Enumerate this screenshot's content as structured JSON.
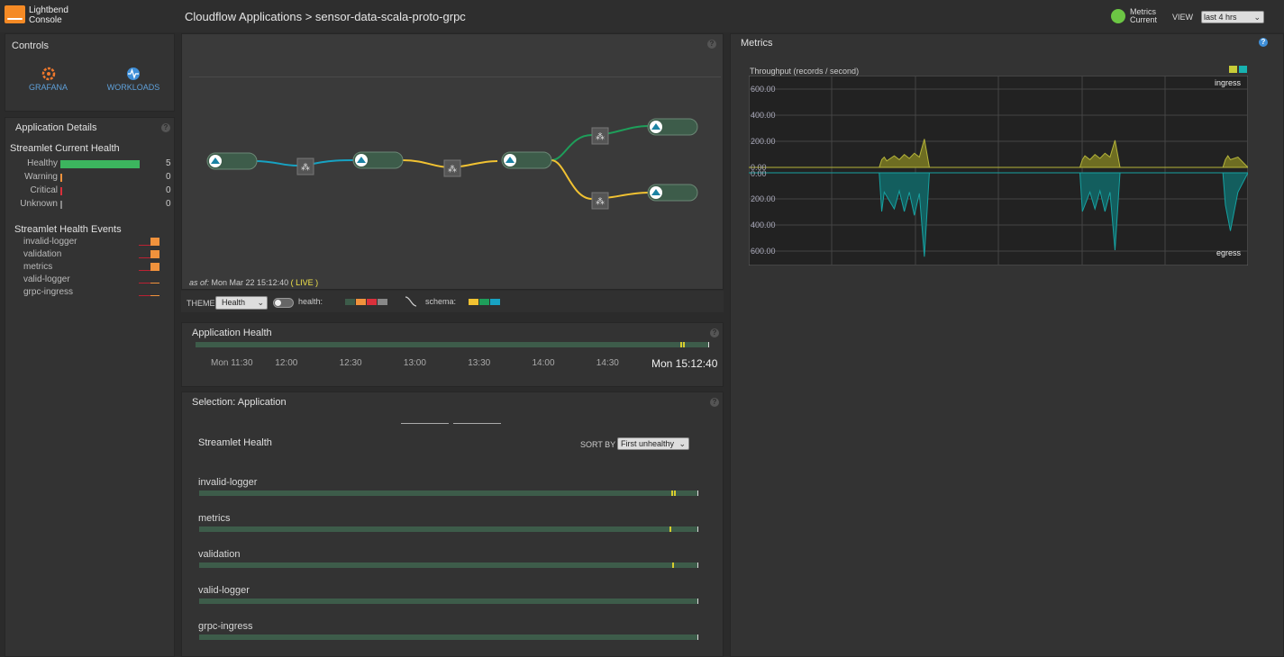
{
  "header": {
    "brand_line1": "Lightbend",
    "brand_line2": "Console",
    "breadcrumb": "Cloudflow Applications > sensor-data-scala-proto-grpc",
    "metrics_status_line1": "Metrics",
    "metrics_status_line2": "Current",
    "view_label": "VIEW",
    "view_value": "last 4 hrs"
  },
  "controls": {
    "title": "Controls",
    "grafana_label": "GRAFANA",
    "workloads_label": "WORKLOADS"
  },
  "app_details": {
    "title": "Application Details",
    "current_health_title": "Streamlet Current Health",
    "health_rows": [
      {
        "label": "Healthy",
        "count": "5",
        "fraction": 1.0,
        "color": "#3cb55e"
      },
      {
        "label": "Warning",
        "count": "0",
        "fraction": 0,
        "color": "#f0923c"
      },
      {
        "label": "Critical",
        "count": "0",
        "fraction": 0,
        "color": "#d9303b"
      },
      {
        "label": "Unknown",
        "count": "0",
        "fraction": 0,
        "color": "#888888"
      }
    ],
    "events_title": "Streamlet Health Events",
    "events": [
      "invalid-logger",
      "validation",
      "metrics",
      "valid-logger",
      "grpc-ingress"
    ]
  },
  "graph": {
    "as_of_label": "as of:",
    "as_of_time": "Mon Mar 22 15:12:40",
    "live_label": "( LIVE )",
    "theme_label": "THEME",
    "theme_value": "Health",
    "health_label": "health:",
    "schema_label": "schema:",
    "health_colors": [
      "#3d5c4a",
      "#f0923c",
      "#d9303b",
      "#888888"
    ],
    "schema_colors": [
      "#f1c232",
      "#1e9e5a",
      "#17a2c2"
    ]
  },
  "app_health": {
    "title": "Application Health",
    "ticks": [
      "Mon 11:30",
      "12:00",
      "12:30",
      "13:00",
      "13:30",
      "14:00",
      "14:30"
    ],
    "current_time": "Mon 15:12:40"
  },
  "selection": {
    "title": "Selection: Application",
    "streamlet_health_label": "Streamlet Health",
    "sort_label": "SORT BY",
    "sort_value": "First unhealthy",
    "streamlets": [
      {
        "name": "invalid-logger",
        "marks": [
          0.945,
          0.952
        ]
      },
      {
        "name": "metrics",
        "marks": [
          0.942
        ]
      },
      {
        "name": "validation",
        "marks": [
          0.947
        ]
      },
      {
        "name": "valid-logger",
        "marks": []
      },
      {
        "name": "grpc-ingress",
        "marks": []
      }
    ]
  },
  "metrics": {
    "title": "Metrics",
    "chart_title": "Throughput (records / second)",
    "legend_colors": [
      "#c8cc38",
      "#17b2b0"
    ]
  },
  "chart_data": {
    "type": "area",
    "title": "Throughput (records / second)",
    "xlabel": "",
    "ylabel": "",
    "series": [
      {
        "name": "ingress",
        "color": "#9c9b2e",
        "x_index": [
          0,
          52,
          53,
          54,
          55,
          58,
          60,
          62,
          64,
          66,
          68,
          70,
          72,
          80,
          100,
          132,
          133,
          134,
          136,
          138,
          140,
          142,
          144,
          146,
          148,
          150,
          160,
          180,
          189,
          190,
          191,
          192,
          195,
          199
        ],
        "values": [
          0,
          0,
          60,
          80,
          50,
          90,
          60,
          100,
          70,
          110,
          80,
          220,
          0,
          0,
          0,
          0,
          60,
          90,
          60,
          100,
          70,
          110,
          80,
          210,
          0,
          0,
          0,
          0,
          0,
          60,
          90,
          60,
          80,
          0
        ]
      },
      {
        "name": "egress",
        "color": "#17a2a2",
        "x_index": [
          0,
          52,
          53,
          54,
          58,
          60,
          62,
          64,
          66,
          68,
          70,
          72,
          80,
          100,
          132,
          133,
          136,
          138,
          140,
          142,
          144,
          146,
          148,
          150,
          160,
          180,
          189,
          190,
          192,
          195,
          199
        ],
        "values": [
          0,
          0,
          300,
          150,
          280,
          140,
          300,
          150,
          330,
          160,
          650,
          0,
          0,
          0,
          0,
          300,
          150,
          280,
          140,
          300,
          150,
          600,
          0,
          0,
          0,
          0,
          0,
          250,
          450,
          150,
          0
        ]
      }
    ],
    "yticks_top": [
      "600.00",
      "400.00",
      "200.00",
      "0.00"
    ],
    "yticks_bottom": [
      "0.00",
      "200.00",
      "400.00",
      "600.00"
    ],
    "ylim": [
      0,
      700
    ],
    "grid": true,
    "legend": "top-right"
  }
}
